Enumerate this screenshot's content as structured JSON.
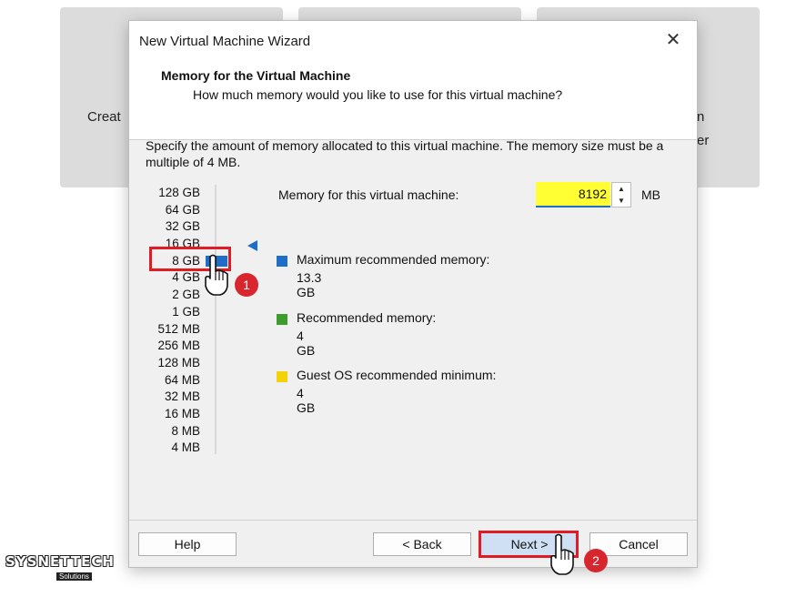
{
  "background": {
    "left_card_text": "Creat",
    "right_card_text_1": "n",
    "right_card_text_2": "er"
  },
  "dialog": {
    "title": "New Virtual Machine Wizard",
    "close_symbol": "✕",
    "header_title": "Memory for the Virtual Machine",
    "header_subtitle": "How much memory would you like to use for this virtual machine?",
    "description": "Specify the amount of memory allocated to this virtual machine. The memory size must be a multiple of 4 MB.",
    "scale": [
      "128 GB",
      "64 GB",
      "32 GB",
      "16 GB",
      "8 GB",
      "4 GB",
      "2 GB",
      "1 GB",
      "512 MB",
      "256 MB",
      "128 MB",
      "64 MB",
      "32 MB",
      "16 MB",
      "8 MB",
      "4 MB"
    ],
    "memory_label": "Memory for this virtual machine:",
    "memory_value": "8192",
    "memory_unit": "MB",
    "legend": [
      {
        "label": "Maximum recommended memory:",
        "value": "13.3 GB",
        "color": "#1e6ec8"
      },
      {
        "label": "Recommended memory:",
        "value": "4 GB",
        "color": "#3c9c2c"
      },
      {
        "label": "Guest OS recommended minimum:",
        "value": "4 GB",
        "color": "#f4d20a"
      }
    ],
    "buttons": {
      "help": "Help",
      "back": "< Back",
      "next": "Next >",
      "cancel": "Cancel"
    }
  },
  "annotations": {
    "step1": "1",
    "step2": "2",
    "highlight_color": "#e01b24"
  },
  "watermark": {
    "brand": "SYSNETTECH",
    "sub": "Solutions"
  },
  "icons": [
    "close-icon",
    "spin-up-icon",
    "spin-down-icon",
    "hand-cursor-icon",
    "max-marker-icon"
  ]
}
